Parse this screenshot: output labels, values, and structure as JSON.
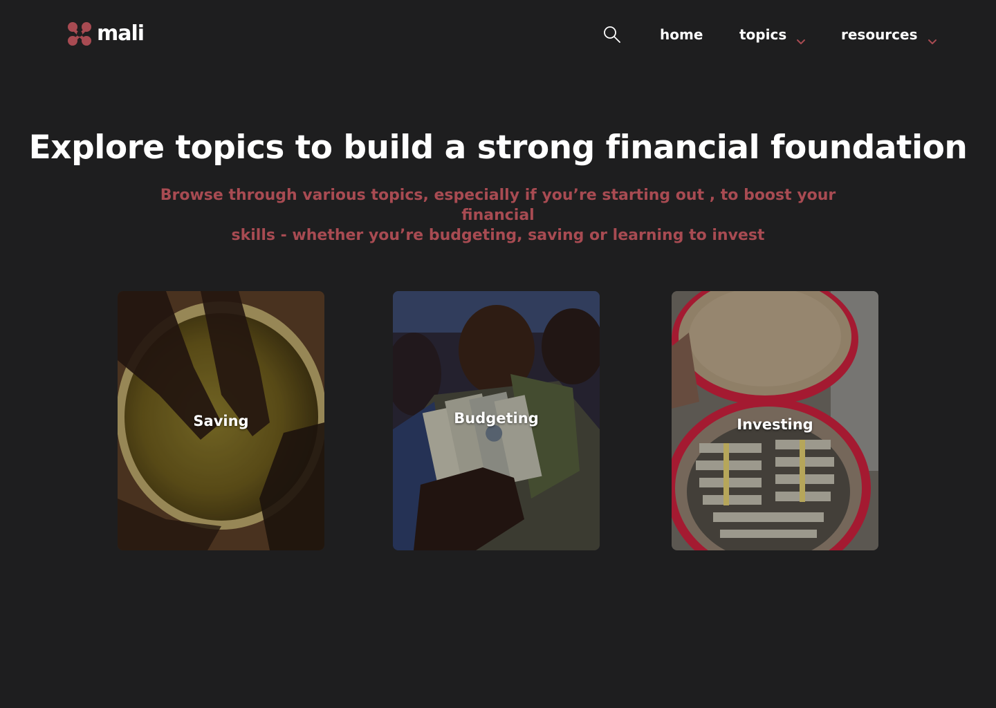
{
  "header": {
    "logo_text": "mali",
    "nav": {
      "home": "home",
      "topics": "topics",
      "resources": "resources"
    }
  },
  "hero": {
    "title": "Explore topics to build a strong financial foundation",
    "subtitle_line1": "Browse through various topics, especially if you’re starting out , to boost your financial",
    "subtitle_line2": "skills - whether you’re budgeting, saving or learning to invest"
  },
  "cards": [
    {
      "label": "Saving",
      "image": "gold-bowl-hands-photo"
    },
    {
      "label": "Budgeting",
      "image": "crowd-holding-dollar-bills-photo"
    },
    {
      "label": "Investing",
      "image": "basket-of-money-stacks-photo"
    }
  ],
  "colors": {
    "background": "#1e1e1f",
    "accent": "#a84b52",
    "text": "#ffffff"
  }
}
